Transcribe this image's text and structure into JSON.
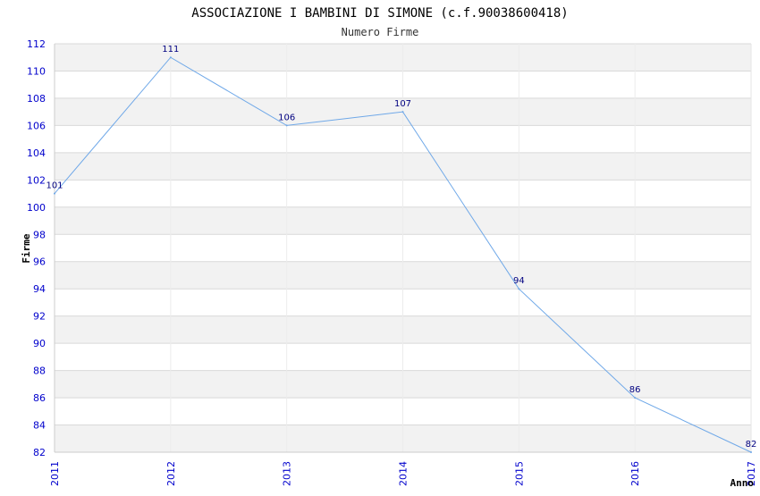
{
  "chart_data": {
    "type": "line",
    "title": "ASSOCIAZIONE I BAMBINI DI SIMONE (c.f.90038600418)",
    "subtitle": "Numero Firme",
    "xlabel": "Anno",
    "ylabel": "Firme",
    "x": [
      "2011",
      "2012",
      "2013",
      "2014",
      "2015",
      "2016",
      "2017"
    ],
    "series": [
      {
        "values": [
          101,
          111,
          106,
          107,
          94,
          86,
          82
        ]
      }
    ],
    "ylim": [
      82,
      112
    ],
    "yticks": [
      82,
      84,
      86,
      88,
      90,
      92,
      94,
      96,
      98,
      100,
      102,
      104,
      106,
      108,
      110,
      112
    ],
    "grid": true,
    "colors": {
      "line": "#6fa8e8",
      "data_label": "#000080",
      "tick_label": "#0000cc",
      "band": "#f2f2f2",
      "grid": "#d9d9d9",
      "title": "#000000"
    }
  }
}
